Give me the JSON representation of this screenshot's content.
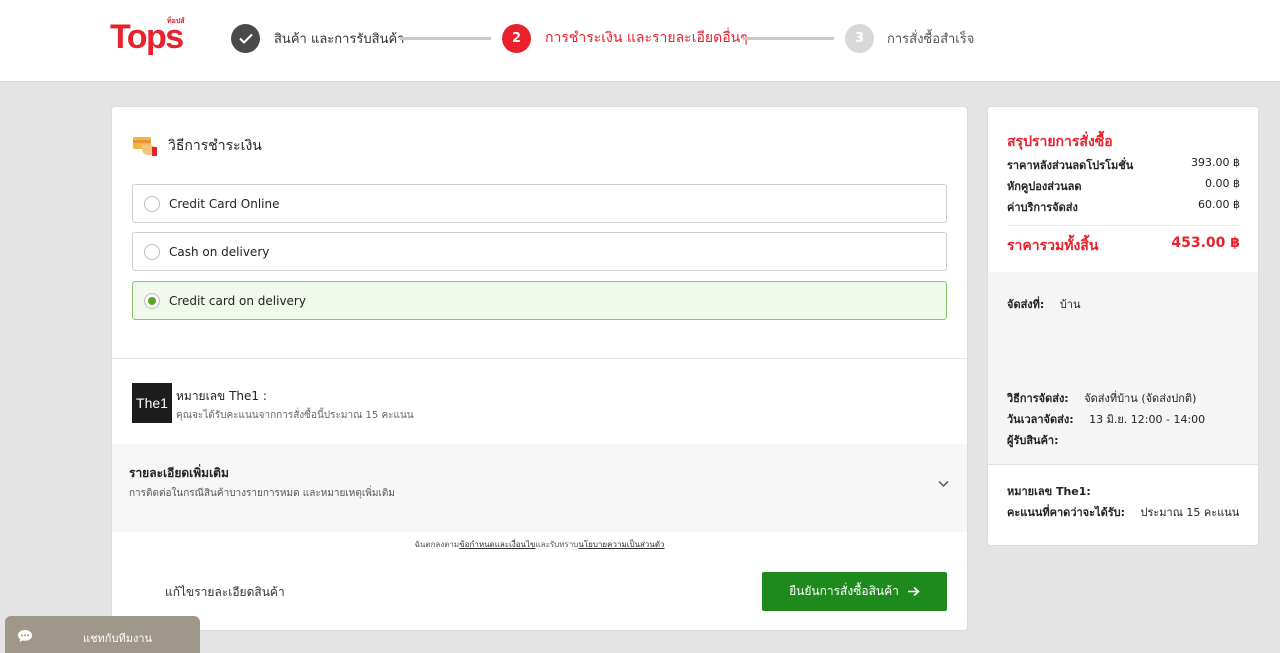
{
  "logo": {
    "brand": "Tops",
    "sub": "ท็อปส์"
  },
  "steps": [
    {
      "num": "✓",
      "label": "สินค้า และการรับสินค้า",
      "state": "done"
    },
    {
      "num": "2",
      "label": "การชำระเงิน และรายละเอียดอื่นๆ",
      "state": "active"
    },
    {
      "num": "3",
      "label": "การสั่งซื้อสำเร็จ",
      "state": "pending"
    }
  ],
  "payment": {
    "title": "วิธีการชำระเงิน",
    "options": [
      {
        "label": "Credit Card Online",
        "selected": false
      },
      {
        "label": "Cash on delivery",
        "selected": false
      },
      {
        "label": "Credit card on delivery",
        "selected": true
      }
    ]
  },
  "the1": {
    "logo_text": "The1",
    "title": "หมายเลข The1 :",
    "desc": "คุณจะได้รับคะแนนจากการสั่งซื้อนี้ประมาณ 15 คะแนน"
  },
  "more_details": {
    "title": "รายละเอียดเพิ่มเติม",
    "desc": "การติดต่อในกรณีสินค้าบางรายการหมด และหมายเหตุเพิ่มเติม"
  },
  "terms": {
    "prefix": "ฉันตกลงตาม",
    "link1": "ข้อกำหนดและเงื่อนไข",
    "middle": "และรับทราบ",
    "link2": "นโยบายความเป็นส่วนตัว"
  },
  "actions": {
    "edit_label": "แก้ไขรายละเอียดสินค้า",
    "confirm_label": "ยืนยันการสั่งซื้อสินค้า"
  },
  "summary": {
    "title": "สรุปรายการสั่งซื้อ",
    "rows": [
      {
        "label": "ราคาหลังส่วนลดโปรโมชั่น",
        "value": "393.00 ฿"
      },
      {
        "label": "หักคูปองส่วนลด",
        "value": "0.00 ฿"
      },
      {
        "label": "ค่าบริการจัดส่ง",
        "value": "60.00 ฿"
      }
    ],
    "total_label": "ราคารวมทั้งสิ้น",
    "total_value": "453.00 ฿",
    "ship_to_label": "จัดส่งที่:",
    "ship_to_value": "บ้าน",
    "method_label": "วิธีการจัดส่ง:",
    "method_value": "จัดส่งที่บ้าน (จัดส่งปกติ)",
    "time_label": "วันเวลาจัดส่ง:",
    "time_value": "13 มิ.ย. 12:00 - 14:00",
    "receiver_label": "ผู้รับสินค้า:",
    "the1_label": "หมายเลข The1:",
    "points_label": "คะแนนที่คาดว่าจะได้รับ:",
    "points_value": "ประมาณ 15 คะแนน"
  },
  "chat": {
    "label": "แชทกับทีมงาน"
  },
  "colors": {
    "brand": "#e8212d",
    "confirm": "#1e8a1e",
    "selected_bg": "#f1f9ec"
  }
}
